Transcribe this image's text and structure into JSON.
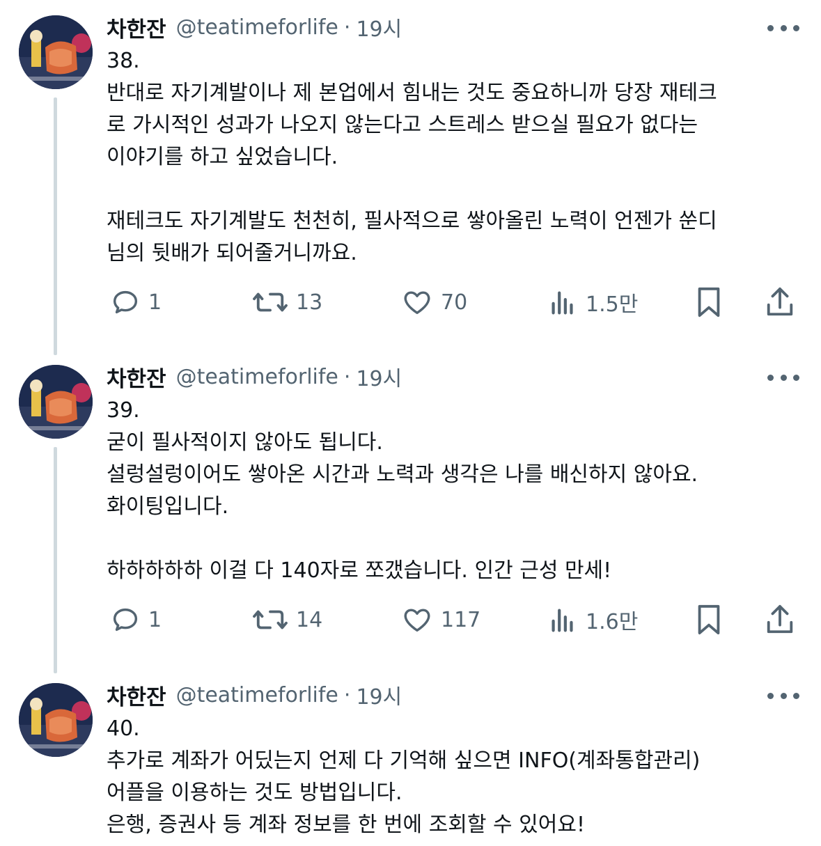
{
  "tweets": [
    {
      "author": {
        "name": "차한잔",
        "handle": "@teatimeforlife"
      },
      "separator": "·",
      "time": "19시",
      "text_lines": [
        "38.",
        "반대로 자기계발이나 제 본업에서 힘내는 것도 중요하니까 당장 재테크",
        "로 가시적인 성과가 나오지 않는다고 스트레스 받으실 필요가 없다는",
        "이야기를 하고 싶었습니다.",
        "",
        "재테크도 자기계발도 천천히, 필사적으로 쌓아올린 노력이 언젠가 쑨디",
        "님의 뒷배가 되어줄거니까요."
      ],
      "stats": {
        "replies": "1",
        "reposts": "13",
        "likes": "70",
        "views": "1.5만"
      }
    },
    {
      "author": {
        "name": "차한잔",
        "handle": "@teatimeforlife"
      },
      "separator": "·",
      "time": "19시",
      "text_lines": [
        "39.",
        "굳이 필사적이지 않아도 됩니다.",
        "설렁설렁이어도 쌓아온 시간과 노력과 생각은 나를 배신하지 않아요.",
        "화이팅입니다.",
        "",
        "하하하하하 이걸 다 140자로 쪼갰습니다. 인간 근성 만세!"
      ],
      "stats": {
        "replies": "1",
        "reposts": "14",
        "likes": "117",
        "views": "1.6만"
      }
    },
    {
      "author": {
        "name": "차한잔",
        "handle": "@teatimeforlife"
      },
      "separator": "·",
      "time": "19시",
      "text_lines": [
        "40.",
        "추가로 계좌가 어딨는지 언제 다 기억해 싶으면 INFO(계좌통합관리)",
        "어플을 이용하는 것도 방법입니다.",
        "은행, 증권사 등 계좌 정보를 한 번에 조회할 수 있어요!"
      ],
      "stats": null
    }
  ],
  "icons": {
    "reply": "reply-icon",
    "repost": "repost-icon",
    "like": "heart-icon",
    "views": "analytics-icon",
    "bookmark": "bookmark-icon",
    "share": "share-icon",
    "more": "more-icon"
  },
  "colors": {
    "text_primary": "#0f1419",
    "text_secondary": "#536471",
    "thread_line": "#cfd9de"
  }
}
